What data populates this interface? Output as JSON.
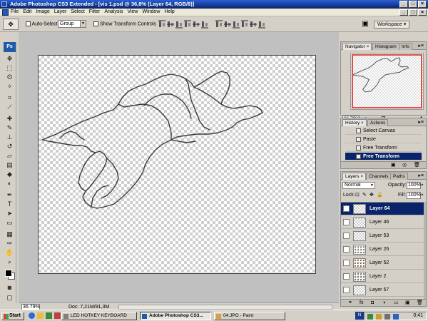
{
  "window": {
    "title": "Adobe Photoshop CS3 Extended - [vis 1.psd @ 36,8% (Layer 64, RGB/8)]",
    "minimize": "_",
    "maximize": "□",
    "close": "×"
  },
  "menu": [
    "File",
    "Edit",
    "Image",
    "Layer",
    "Select",
    "Filter",
    "Analysis",
    "View",
    "Window",
    "Help"
  ],
  "options": {
    "auto_select_label": "Auto-Select:",
    "auto_select_value": "Group",
    "show_transform_label": "Show Transform Controls",
    "workspace_label": "Workspace ▾"
  },
  "toolbox": {
    "logo": "Ps"
  },
  "status": {
    "zoom": "36.79%",
    "doc": "Doc: 7,21M/91,3M"
  },
  "navigator": {
    "tabs": [
      "Navigator ×",
      "Histogram",
      "Info"
    ],
    "zoom": "36.79%"
  },
  "history": {
    "tabs": [
      "History ×",
      "Actions"
    ],
    "items": [
      {
        "label": "Select Canvas",
        "selected": false
      },
      {
        "label": "Paste",
        "selected": false
      },
      {
        "label": "Free Transform",
        "selected": false
      },
      {
        "label": "Free Transform",
        "selected": true
      }
    ]
  },
  "layers": {
    "tabs": [
      "Layers ×",
      "Channels",
      "Paths"
    ],
    "blend_mode": "Normal",
    "opacity_label": "Opacity:",
    "opacity_value": "100%",
    "lock_label": "Lock:",
    "fill_label": "Fill:",
    "fill_value": "100%",
    "items": [
      {
        "name": "Layer 64",
        "selected": true,
        "visible": true
      },
      {
        "name": "Layer 46",
        "selected": false,
        "visible": false
      },
      {
        "name": "Layer 53",
        "selected": false,
        "visible": false
      },
      {
        "name": "Layer 26",
        "selected": false,
        "visible": false
      },
      {
        "name": "Layer 52",
        "selected": false,
        "visible": false
      },
      {
        "name": "Layer 2",
        "selected": false,
        "visible": false
      },
      {
        "name": "Layer 57",
        "selected": false,
        "visible": false
      }
    ]
  },
  "taskbar": {
    "start": "Start",
    "tasks": [
      {
        "label": "LED HOTKEY KEYBOARD",
        "active": false
      },
      {
        "label": "Adobe Photoshop CS3...",
        "active": true
      },
      {
        "label": "04.JPG - Paint",
        "active": false
      }
    ],
    "clock": "0:41"
  },
  "colors": {
    "title_bar": "#0a246a",
    "selection": "#0a246a",
    "navigator_viewbox": "#e0504a"
  }
}
